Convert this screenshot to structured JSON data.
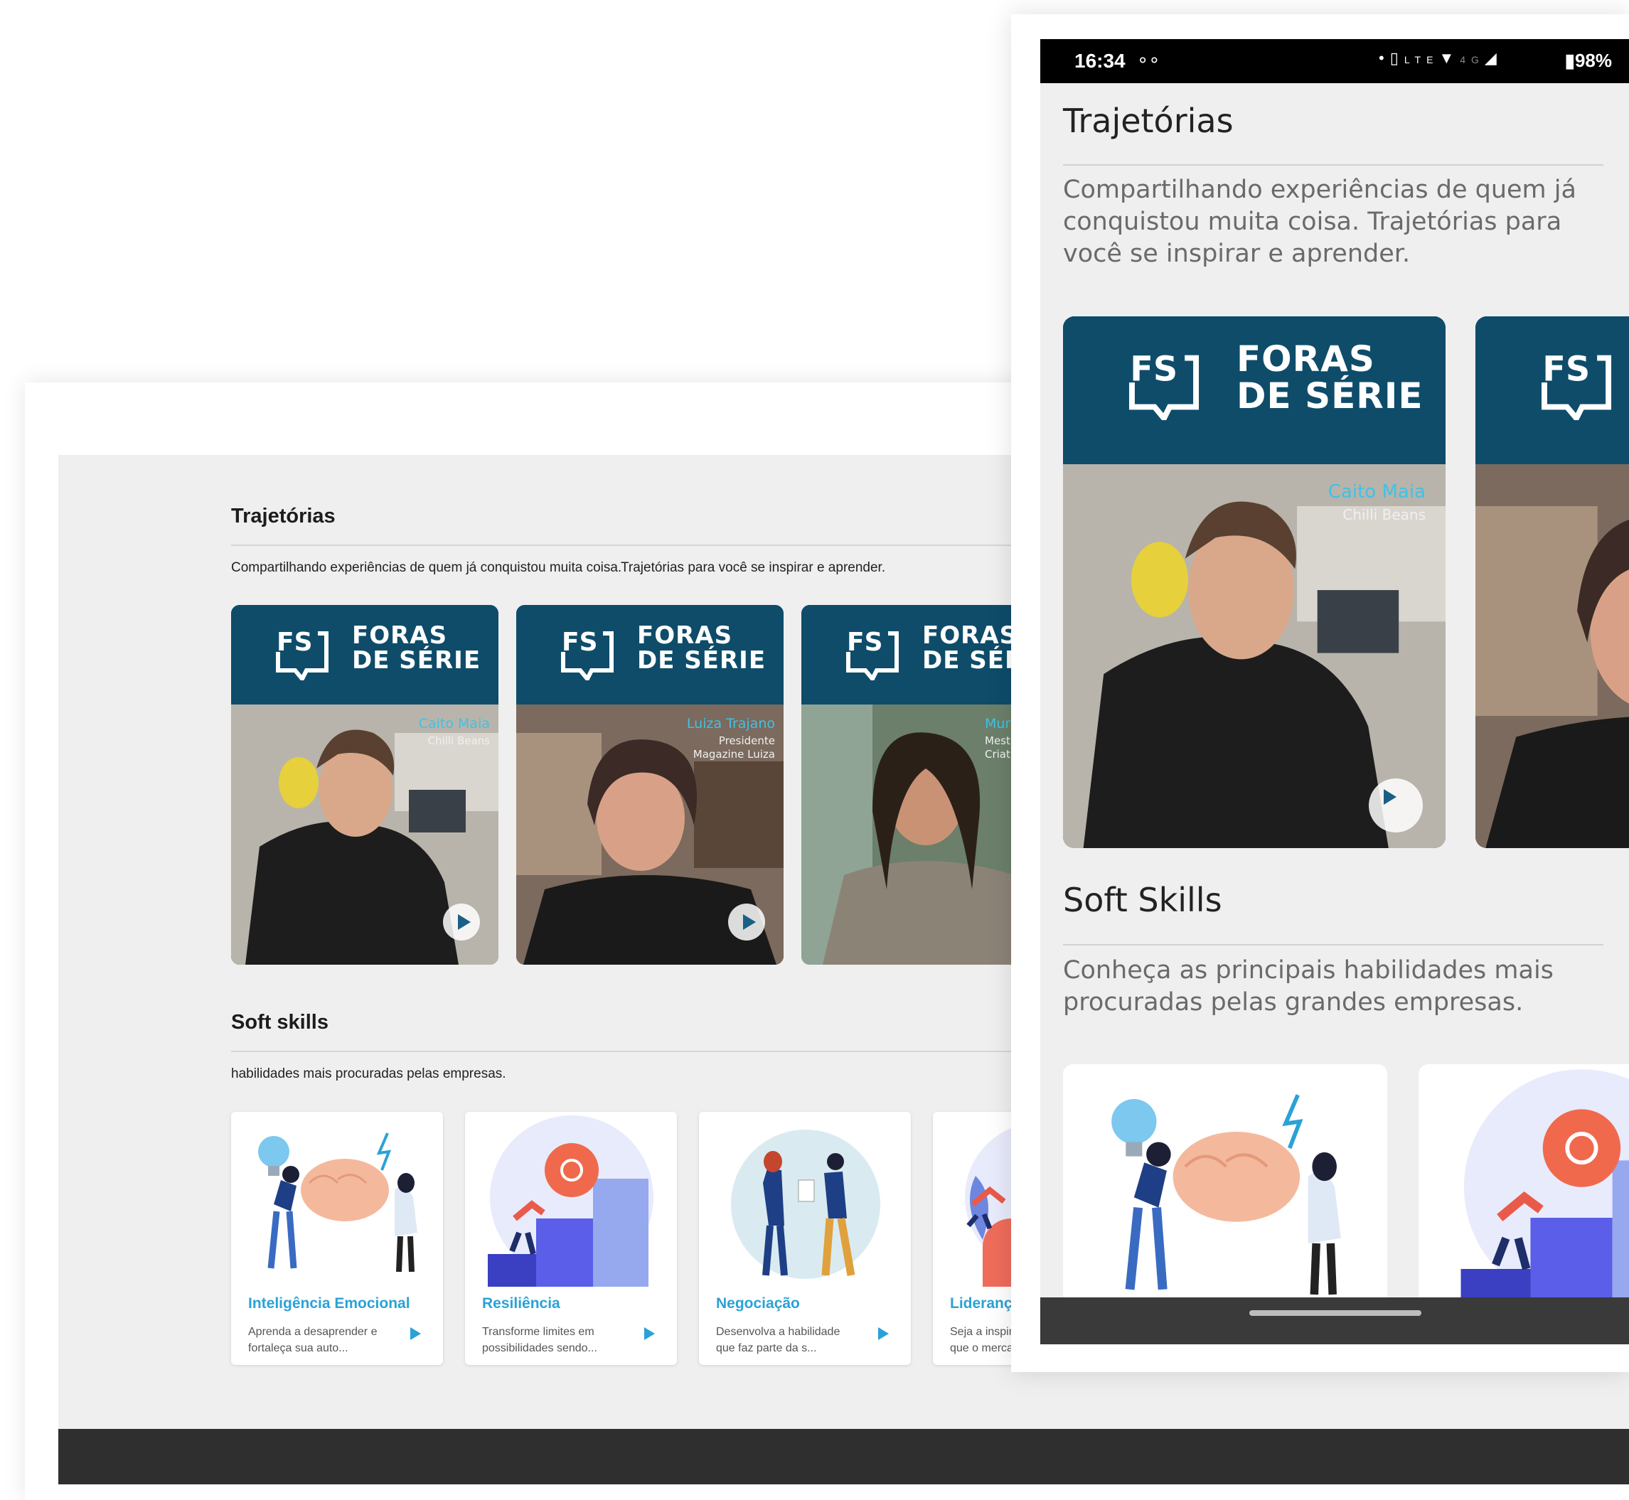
{
  "desktop": {
    "trajetorias": {
      "title": "Trajetórias",
      "subtitle_a": "Compartilhando experiências de quem já conquistou muita coisa.",
      "subtitle_b": "Trajetórias para você se inspirar e aprender."
    },
    "fs_brand": {
      "line1": "FORAS",
      "line2": "DE SÉRIE",
      "logo_text": "FS"
    },
    "cards": [
      {
        "name": "Caito Maia",
        "role_line1": "Chilli Beans",
        "role_line2": ""
      },
      {
        "name": "Luiza Trajano",
        "role_line1": "Presidente",
        "role_line2": "Magazine Luiza"
      },
      {
        "name": "Murilo G",
        "role_line1": "Mestre em",
        "role_line2": "Criatividad"
      }
    ],
    "soft_skills": {
      "title": "Soft skills",
      "subtitle": "habilidades mais procuradas pelas empresas.",
      "items": [
        {
          "title": "Inteligência Emocional",
          "desc": "Aprenda a desaprender e fortaleça sua auto..."
        },
        {
          "title": "Resiliência",
          "desc": "Transforme limites em possibilidades sendo..."
        },
        {
          "title": "Negociação",
          "desc": "Desenvolva a habilidade que faz parte da s..."
        },
        {
          "title": "Liderança",
          "desc": "Seja a inspiração d líder que o merca"
        }
      ]
    }
  },
  "mobile": {
    "status": {
      "time": "16:34",
      "battery": "98%",
      "network": "4G"
    },
    "trajetorias": {
      "title": "Trajetórias",
      "subtitle": "Compartilhando experiências de quem já conquistou muita coisa. Trajetórias para você se inspirar e aprender."
    },
    "card": {
      "name": "Caito Maia",
      "role": "Chilli Beans"
    },
    "soft_skills": {
      "title": "Soft Skills",
      "subtitle": "Conheça as principais habilidades mais procuradas pelas grandes empresas."
    }
  },
  "colors": {
    "brand_teal": "#0e4c6a",
    "accent_blue": "#2aa2d6",
    "name_cyan": "#3fc2e6",
    "bg": "#efefef"
  }
}
